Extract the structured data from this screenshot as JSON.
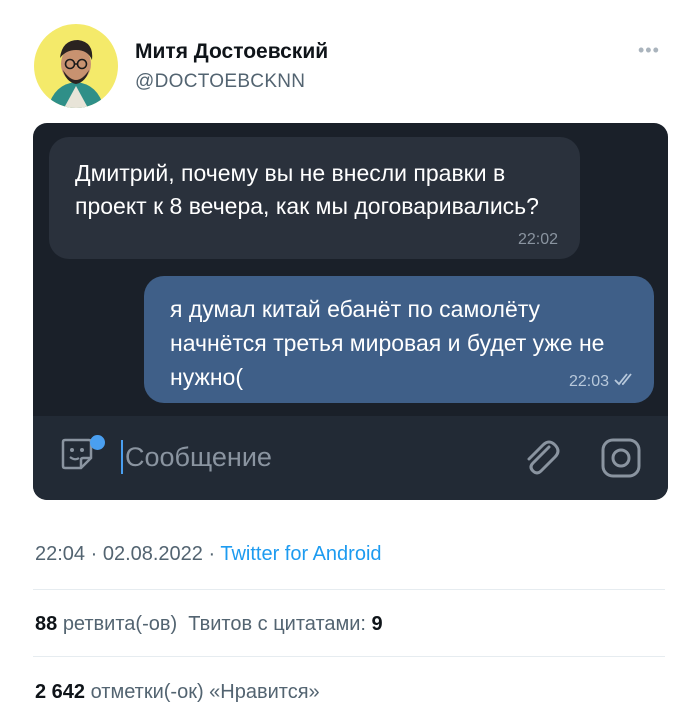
{
  "tweet": {
    "author_name": "Митя Достоевский",
    "author_handle": "@DOCTOEBCKNN",
    "more_icon": "more-dots-icon",
    "timestamp": "22:04 · 02.08.2022",
    "separator": " · ",
    "source": "Twitter for Android",
    "retweets_count": "88",
    "retweets_label": "ретвита(-ов)",
    "quotes_label": "Твитов с цитатами:",
    "quotes_count": "9",
    "likes_count": "2 642",
    "likes_label": "отметки(-ок) «Нравится»"
  },
  "chat": {
    "incoming": {
      "text": "Дмитрий, почему вы не внесли правки в проект к 8 вечера, как мы договаривались?",
      "time": "22:02"
    },
    "outgoing": {
      "text": "я думал китай ебанёт по самолёту начнётся третья мировая и будет уже не нужно(",
      "time": "22:03",
      "status_icon": "double-check-icon"
    },
    "composer": {
      "placeholder": "Сообщение",
      "sticker_icon": "sticker-icon",
      "attach_icon": "paperclip-icon",
      "camera_icon": "camera-icon"
    }
  },
  "colors": {
    "link": "#1d9bf0",
    "chat_bg": "#1a2029",
    "incoming_bubble": "#2a313c",
    "outgoing_bubble": "#3f5f88",
    "accent": "#4a9ff0"
  }
}
